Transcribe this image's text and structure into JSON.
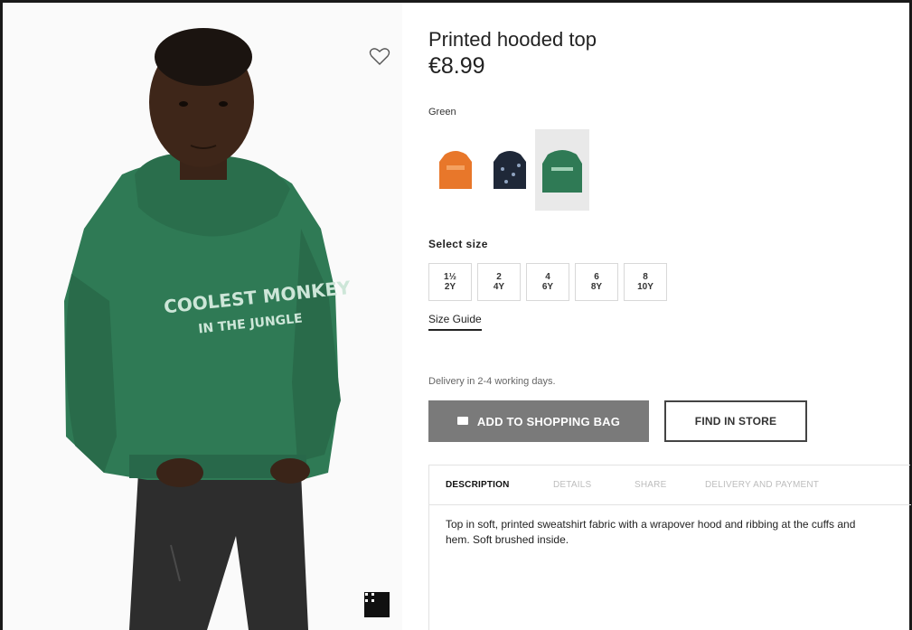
{
  "product": {
    "title": "Printed hooded top",
    "price": "€8.99",
    "color": "Green",
    "swatches": [
      {
        "name": "orange",
        "color": "#e8772a"
      },
      {
        "name": "navy",
        "color": "#1f2838"
      },
      {
        "name": "green",
        "color": "#2f7a55",
        "selected": true
      }
    ],
    "model_shirt_text": [
      "COOLEST MONKEY",
      "IN THE JUNGLE"
    ]
  },
  "sizes": {
    "label": "Select size",
    "options": [
      {
        "top": "1½",
        "bottom": "2Y"
      },
      {
        "top": "2",
        "bottom": "4Y"
      },
      {
        "top": "4",
        "bottom": "6Y"
      },
      {
        "top": "6",
        "bottom": "8Y"
      },
      {
        "top": "8",
        "bottom": "10Y"
      }
    ],
    "guide_label": "Size Guide"
  },
  "delivery": "Delivery in 2-4 working days.",
  "actions": {
    "add_to_bag": "ADD TO SHOPPING BAG",
    "find_in_store": "FIND IN STORE"
  },
  "info": {
    "tabs": [
      {
        "label": "DESCRIPTION",
        "active": true
      },
      {
        "label": "DETAILS",
        "active": false
      },
      {
        "label": "SHARE",
        "active": false
      },
      {
        "label": "DELIVERY AND PAYMENT",
        "active": false
      }
    ],
    "description": "Top in soft, printed sweatshirt fabric with a wrapover hood and ribbing at the cuffs and hem. Soft brushed inside."
  },
  "icons": {
    "wishlist": "heart-outline-icon",
    "zoom": "expand-icon",
    "bag": "shopping-bag-icon"
  },
  "colors": {
    "hoodie_green": "#2f7a55",
    "primary_button": "#7a7a7a",
    "text": "#222222"
  }
}
